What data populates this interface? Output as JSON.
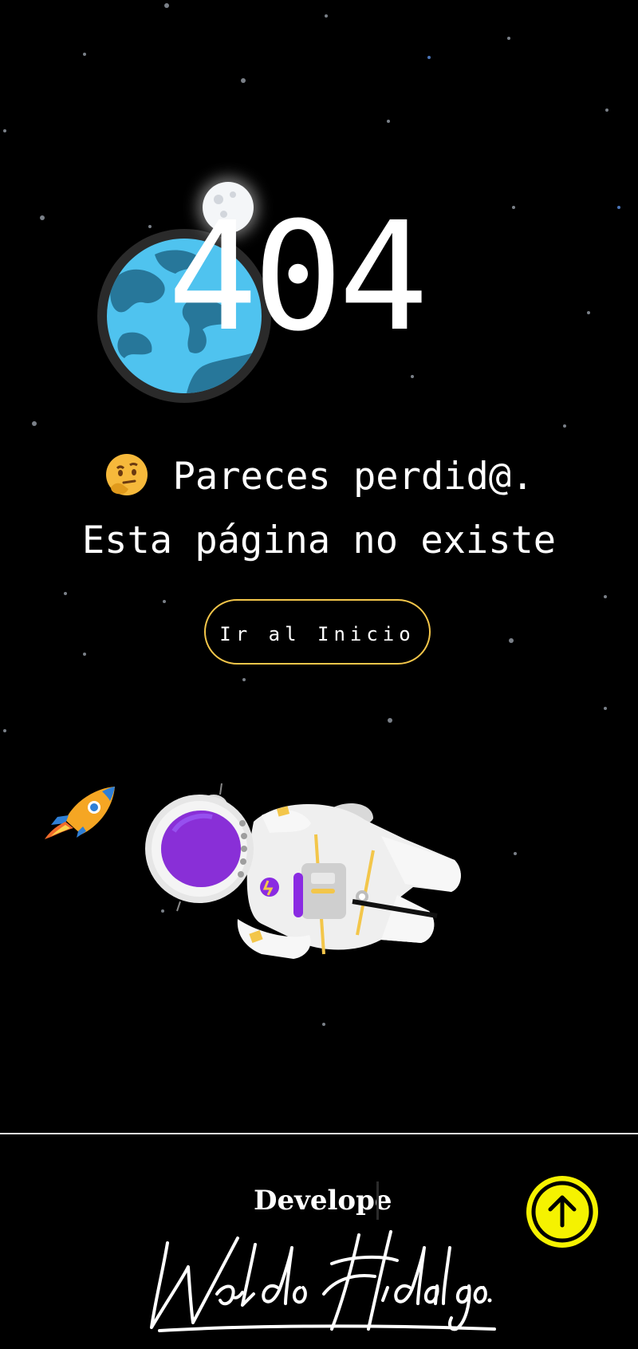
{
  "error": {
    "code": "404",
    "emoji_icon": "thinking-face-icon",
    "message_line1": "Pareces perdid@.",
    "message_line2": "Esta página no existe"
  },
  "actions": {
    "home_label": "Ir al Inicio"
  },
  "decor": {
    "planet_icon": "earth-icon",
    "moon_icon": "moon-icon",
    "rocket_icon": "rocket-icon",
    "astronaut_icon": "astronaut-icon"
  },
  "footer": {
    "developer_label": "Develope",
    "signature": "Waldo Hidalgo.",
    "scroll_top_icon": "arrow-up-circle-icon"
  },
  "colors": {
    "background": "#000000",
    "button_border": "#f3c64a",
    "scroll_top": "#f5f200",
    "earth_ocean": "#4fc3ef",
    "astronaut_visor": "#8a2be2"
  }
}
